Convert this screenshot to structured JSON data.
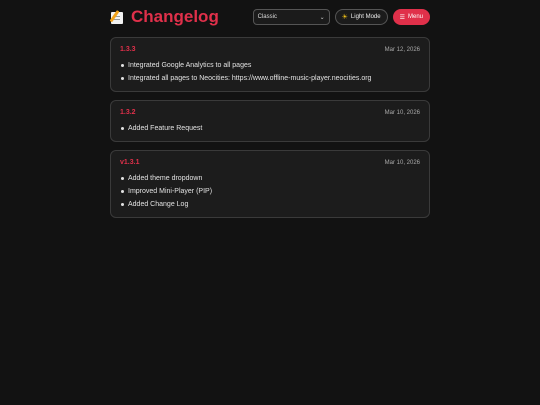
{
  "header": {
    "title": "Changelog",
    "theme_select": {
      "selected": "Classic"
    },
    "light_mode_label": "Light Mode",
    "menu_label": "Menu"
  },
  "entries": [
    {
      "version": "1.3.3",
      "date": "Mar 12, 2026",
      "items": [
        "Integrated Google Analytics to all pages",
        "Integrated all pages to Neocities: https://www.offline-music-player.neocities.org"
      ]
    },
    {
      "version": "1.3.2",
      "date": "Mar 10, 2026",
      "items": [
        "Added Feature Request"
      ]
    },
    {
      "version": "v1.3.1",
      "date": "Mar 10, 2026",
      "items": [
        "Added theme dropdown",
        "Improved Mini-Player (PIP)",
        "Added Change Log"
      ]
    }
  ],
  "colors": {
    "accent": "#e0304a",
    "background": "#121212",
    "card": "#1c1c1c"
  },
  "icons": {
    "title": "memo-icon",
    "light_mode": "sun-icon",
    "menu": "hamburger-icon",
    "select": "chevron-down-icon"
  }
}
